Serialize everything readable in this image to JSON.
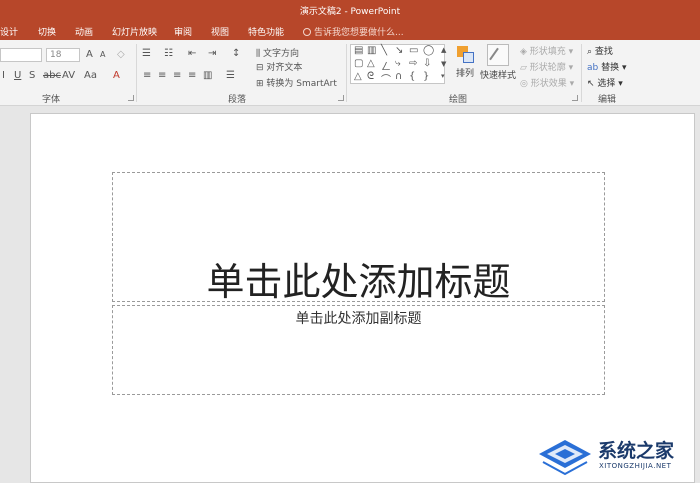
{
  "window": {
    "title": "演示文稿2 - PowerPoint"
  },
  "tabs": [
    {
      "label": "设计"
    },
    {
      "label": "切换"
    },
    {
      "label": "动画"
    },
    {
      "label": "幻灯片放映"
    },
    {
      "label": "审阅"
    },
    {
      "label": "视图"
    },
    {
      "label": "特色功能"
    }
  ],
  "tell_me": {
    "placeholder": "告诉我您想要做什么..."
  },
  "font_group": {
    "label": "字体",
    "font_size": "18",
    "grow_label": "A",
    "shrink_label": "A",
    "clear_label": "Aa",
    "font_color_label": "A"
  },
  "paragraph_group": {
    "label": "段落",
    "text_direction": "文字方向",
    "align_text": "对齐文本",
    "smartart": "转换为 SmartArt"
  },
  "drawing_group": {
    "label": "绘图",
    "arrange": "排列",
    "quick_styles": "快速样式",
    "shape_fill": "形状填充",
    "shape_outline": "形状轮廓",
    "shape_effects": "形状效果"
  },
  "editing_group": {
    "label": "编辑",
    "find": "查找",
    "replace": "替换",
    "select": "选择"
  },
  "slide": {
    "title_placeholder": "单击此处添加标题",
    "subtitle_placeholder": "单击此处添加副标题"
  },
  "watermark": {
    "text": "系统之家",
    "url": "XITONGZHIJIA.NET"
  },
  "colors": {
    "accent": "#b7472a",
    "ribbon": "#f3f3f3"
  }
}
